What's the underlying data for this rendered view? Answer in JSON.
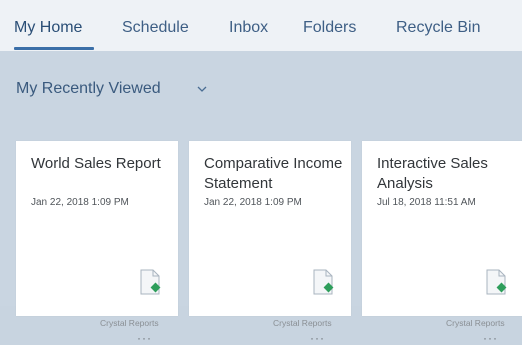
{
  "tabs": [
    {
      "label": "My Home"
    },
    {
      "label": "Schedule"
    },
    {
      "label": "Inbox"
    },
    {
      "label": "Folders"
    },
    {
      "label": "Recycle Bin"
    }
  ],
  "section": {
    "title": "My Recently Viewed"
  },
  "cards": [
    {
      "title": "World Sales Report",
      "date": "Jan 22, 2018 1:09 PM",
      "type": "Crystal Reports",
      "more": "···"
    },
    {
      "title": "Comparative Income Statement",
      "date": "Jan 22, 2018 1:09 PM",
      "type": "Crystal Reports",
      "more": "···"
    },
    {
      "title": "Interactive Sales Analysis",
      "date": "Jul 18, 2018 11:51 AM",
      "type": "Crystal Reports",
      "more": "···"
    }
  ],
  "colors": {
    "accent": "#3b6fa8",
    "tab_text": "#3e5f85",
    "section_bg": "#c9d5e1",
    "doc_badge": "#2e9e5b"
  },
  "icons": {
    "dropdown": "chevron-down-icon",
    "document": "crystal-report-document-icon"
  }
}
